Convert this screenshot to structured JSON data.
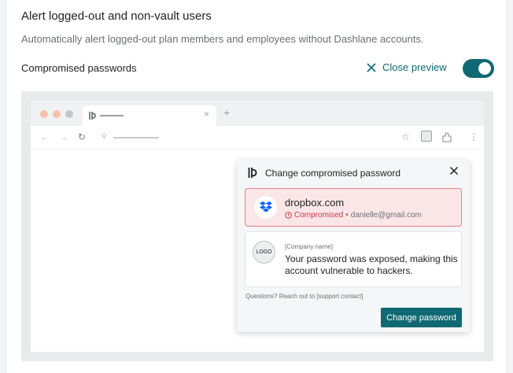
{
  "section": {
    "title": "Alert logged-out and non-vault users",
    "description": "Automatically alert logged-out plan members and employees without Dashlane accounts."
  },
  "setting": {
    "label": "Compromised passwords",
    "close_preview_label": "Close preview",
    "toggle_on": true
  },
  "browser": {
    "tab_close": "×",
    "new_tab": "+",
    "nav_back": "←",
    "nav_forward": "→",
    "reload": "↻",
    "site_settings": "⚲",
    "bookmark": "☆",
    "menu": "⋮"
  },
  "popup": {
    "title": "Change compromised password",
    "credential": {
      "domain": "dropbox.com",
      "status": "Compromised",
      "separator": "•",
      "email": "danielle@gmail.com"
    },
    "message": {
      "logo_text": "LOGO",
      "company": "[Company name]",
      "text": "Your password was exposed, making this account vulnerable to hackers."
    },
    "support": "Questions? Reach out to [support contact]",
    "button_label": "Change password"
  },
  "colors": {
    "accent": "#0e6972",
    "danger": "#d2374a",
    "danger_bg": "#fbe6e7",
    "dropbox_blue": "#0061fe"
  },
  "icons": [
    "close-icon",
    "dashlane-logo-icon",
    "dropbox-icon",
    "alert-circle-icon",
    "extension-icon",
    "star-icon"
  ]
}
